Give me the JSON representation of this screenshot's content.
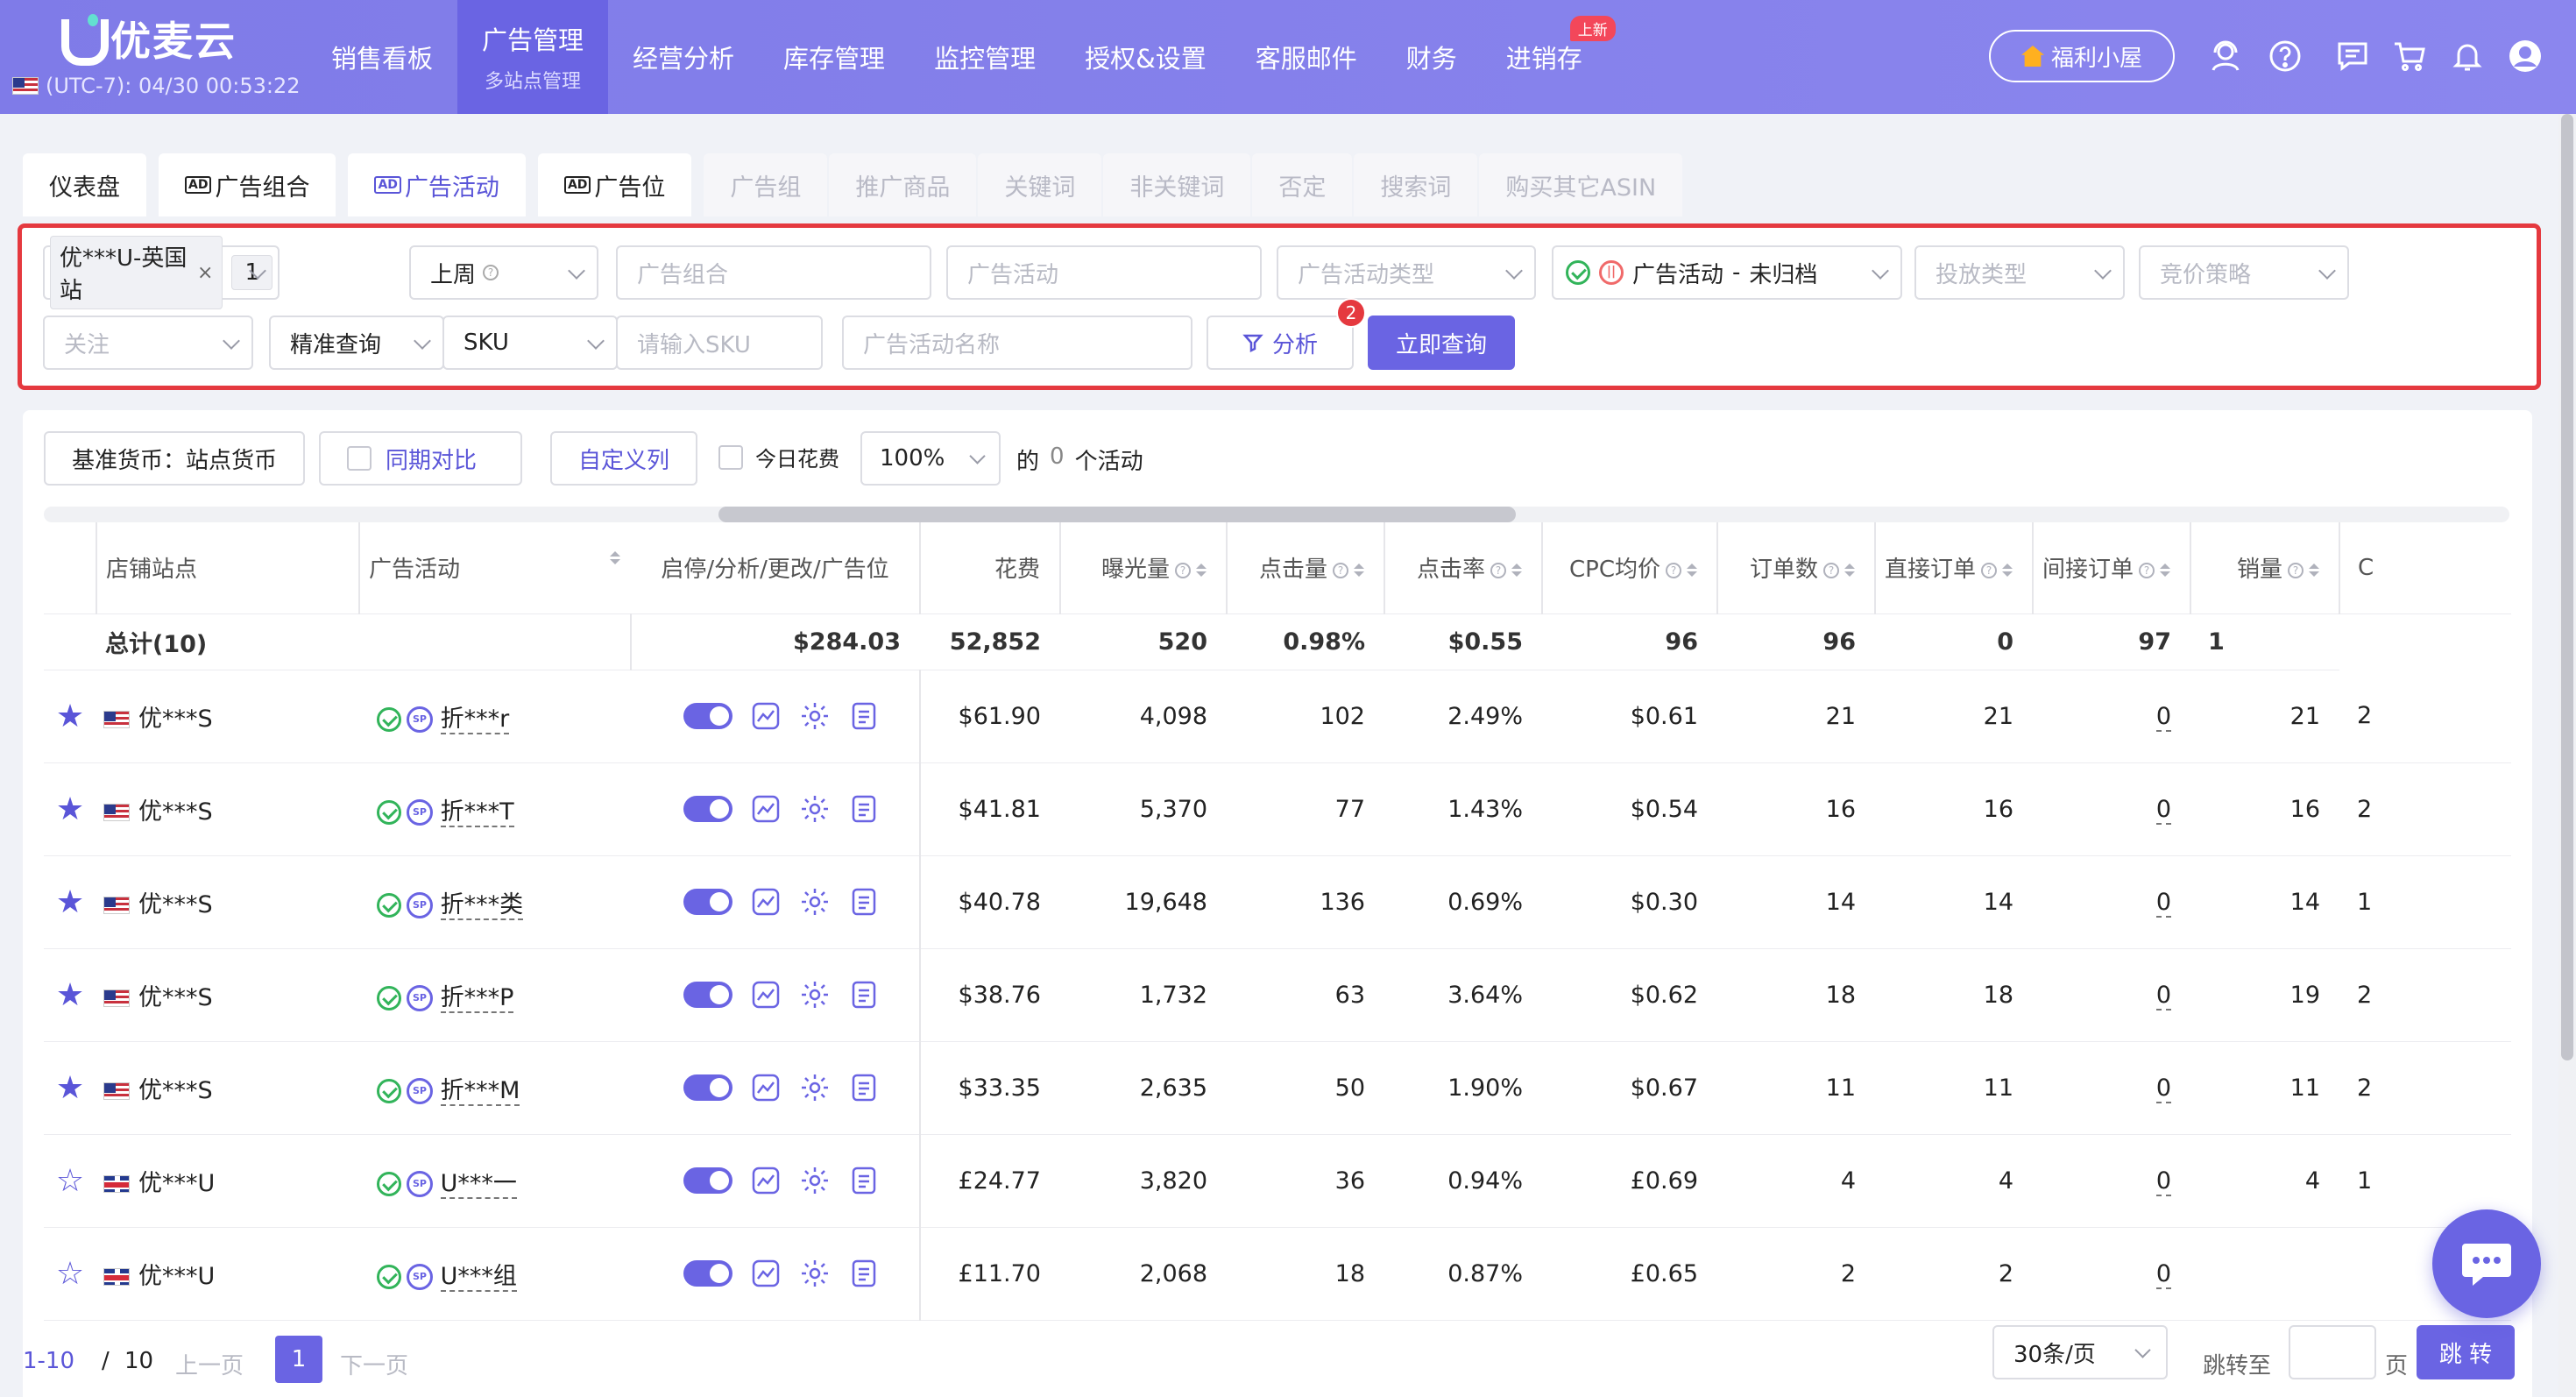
{
  "app": {
    "logo_text": "优麦云",
    "clock": "(UTC-7): 04/30 00:53:22",
    "nav": [
      {
        "label": "销售看板"
      },
      {
        "label": "广告管理",
        "sub": "多站点管理",
        "active": true
      },
      {
        "label": "经营分析"
      },
      {
        "label": "库存管理"
      },
      {
        "label": "监控管理"
      },
      {
        "label": "授权&设置"
      },
      {
        "label": "客服邮件"
      },
      {
        "label": "财务"
      },
      {
        "label": "进销存",
        "badge": "上新"
      }
    ],
    "welfare": "福利小屋",
    "top_icons": [
      "user-headset-icon",
      "help-icon",
      "message-icon",
      "cart-icon",
      "bell-icon",
      "avatar-icon"
    ]
  },
  "tabs": [
    {
      "label": "仪表盘",
      "state": "normal"
    },
    {
      "label": "广告组合",
      "state": "normal",
      "ad_icon": "AD"
    },
    {
      "label": "广告活动",
      "state": "active",
      "ad_icon": "AD"
    },
    {
      "label": "广告位",
      "state": "normal",
      "ad_icon": "AD"
    },
    {
      "label": "广告组",
      "state": "dim"
    },
    {
      "label": "推广商品",
      "state": "dim"
    },
    {
      "label": "关键词",
      "state": "dim"
    },
    {
      "label": "非关键词",
      "state": "dim"
    },
    {
      "label": "否定",
      "state": "dim"
    },
    {
      "label": "搜索词",
      "state": "dim"
    },
    {
      "label": "购买其它ASIN",
      "state": "dim"
    }
  ],
  "filters": {
    "shop_chip": "优***U-英国站",
    "shop_count": "1",
    "period": "上周",
    "ad_portfolio_ph": "广告组合",
    "ad_campaign_ph": "广告活动",
    "campaign_type_ph": "广告活动类型",
    "status_label": "广告活动",
    "status_dash": "-",
    "status_value": "未归档",
    "delivery_type_ph": "投放类型",
    "bid_strategy_ph": "竞价策略",
    "follow_ph": "关注",
    "query_mode": "精准查询",
    "sku_field": "SKU",
    "sku_ph": "请输入SKU",
    "campaign_name_ph": "广告活动名称",
    "analyze_btn": "分析",
    "analyze_badge": "2",
    "query_btn": "立即查询"
  },
  "toolbar": {
    "currency": "基准货币：站点货币",
    "compare": "同期对比",
    "custom_cols": "自定义列",
    "today_spend": "今日花费",
    "zoom": "100%",
    "count_prefix": "的",
    "count_value": "0",
    "count_suffix": "个活动"
  },
  "table": {
    "columns": [
      "店铺站点",
      "广告活动",
      "启停/分析/更改/广告位",
      "花费",
      "曝光量",
      "点击量",
      "点击率",
      "CPC均价",
      "订单数",
      "直接订单",
      "间接订单",
      "销量",
      "C"
    ],
    "total": {
      "label": "总计(10)",
      "spend": "$284.03",
      "impressions": "52,852",
      "clicks": "520",
      "ctr": "0.98%",
      "cpc": "$0.55",
      "orders": "96",
      "direct": "96",
      "indirect": "0",
      "units": "97",
      "extra": "1"
    },
    "rows": [
      {
        "starred": true,
        "flag": "us",
        "store": "优***S",
        "campaign": "折***r",
        "spend": "$61.90",
        "impressions": "4,098",
        "clicks": "102",
        "ctr": "2.49%",
        "cpc": "$0.61",
        "orders": "21",
        "direct": "21",
        "indirect": "0",
        "units": "21",
        "extra": "2"
      },
      {
        "starred": true,
        "flag": "us",
        "store": "优***S",
        "campaign": "折***T",
        "spend": "$41.81",
        "impressions": "5,370",
        "clicks": "77",
        "ctr": "1.43%",
        "cpc": "$0.54",
        "orders": "16",
        "direct": "16",
        "indirect": "0",
        "units": "16",
        "extra": "2"
      },
      {
        "starred": true,
        "flag": "us",
        "store": "优***S",
        "campaign": "折***类",
        "spend": "$40.78",
        "impressions": "19,648",
        "clicks": "136",
        "ctr": "0.69%",
        "cpc": "$0.30",
        "orders": "14",
        "direct": "14",
        "indirect": "0",
        "units": "14",
        "extra": "1"
      },
      {
        "starred": true,
        "flag": "us",
        "store": "优***S",
        "campaign": "折***P",
        "spend": "$38.76",
        "impressions": "1,732",
        "clicks": "63",
        "ctr": "3.64%",
        "cpc": "$0.62",
        "orders": "18",
        "direct": "18",
        "indirect": "0",
        "units": "19",
        "extra": "2"
      },
      {
        "starred": true,
        "flag": "us",
        "store": "优***S",
        "campaign": "折***M",
        "spend": "$33.35",
        "impressions": "2,635",
        "clicks": "50",
        "ctr": "1.90%",
        "cpc": "$0.67",
        "orders": "11",
        "direct": "11",
        "indirect": "0",
        "units": "11",
        "extra": "2"
      },
      {
        "starred": false,
        "flag": "uk",
        "store": "优***U",
        "campaign": "U***一",
        "spend": "£24.77",
        "impressions": "3,820",
        "clicks": "36",
        "ctr": "0.94%",
        "cpc": "£0.69",
        "orders": "4",
        "direct": "4",
        "indirect": "0",
        "units": "4",
        "extra": "1"
      },
      {
        "starred": false,
        "flag": "uk",
        "store": "优***U",
        "campaign": "U***组",
        "spend": "£11.70",
        "impressions": "2,068",
        "clicks": "18",
        "ctr": "0.87%",
        "cpc": "£0.65",
        "orders": "2",
        "direct": "2",
        "indirect": "0",
        "units": "",
        "extra": ""
      }
    ]
  },
  "pager": {
    "range": "1-10",
    "slash": "/",
    "total": "10",
    "prev": "上一页",
    "current": "1",
    "next": "下一页",
    "page_size": "30条/页",
    "jump_to": "跳转至",
    "page_unit": "页",
    "jump_btn": "跳 转"
  },
  "colors": {
    "accent": "#6a64e3",
    "highlight_border": "#e5393f",
    "ok": "#32b45a"
  }
}
